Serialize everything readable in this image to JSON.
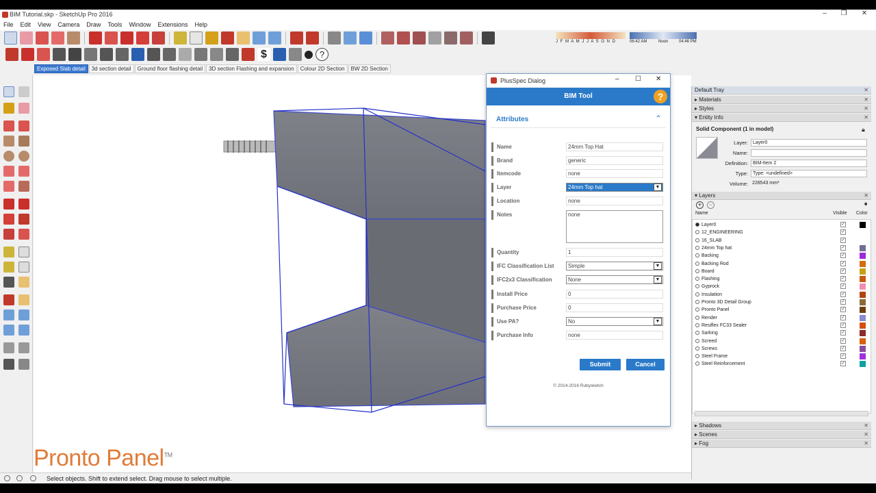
{
  "window": {
    "title": "BIM Tutorial.skp - SketchUp Pro 2016"
  },
  "menu": [
    "File",
    "Edit",
    "View",
    "Camera",
    "Draw",
    "Tools",
    "Window",
    "Extensions",
    "Help"
  ],
  "toolbar_shadow": {
    "months": "J F M A M J J A S O N D",
    "time_start": "06:42 AM",
    "noon": "Noon",
    "time_end": "04:46 PM"
  },
  "scene_tabs": [
    "Exposed Slab detail",
    "3d section detail",
    "Ground floor flashing detail",
    "3D section Flashing and expansion",
    "Colour 2D Section",
    "BW 2D Section"
  ],
  "brand": {
    "name": "Pronto Panel",
    "tm": "TM"
  },
  "status": {
    "message": "Select objects. Shift to extend select. Drag mouse to select multiple."
  },
  "dialog": {
    "title": "PlusSpec Dialog",
    "header": "BIM Tool",
    "help": "?",
    "section": "Attributes",
    "fields": [
      {
        "label": "Name",
        "value": "24mm Top Hat",
        "kind": "text"
      },
      {
        "label": "Brand",
        "value": "generic",
        "kind": "text"
      },
      {
        "label": "Itemcode",
        "value": "none",
        "kind": "text"
      },
      {
        "label": "Layer",
        "value": "24mm Top hat",
        "kind": "select-hl"
      },
      {
        "label": "Location",
        "value": "none",
        "kind": "text"
      },
      {
        "label": "Notes",
        "value": "none",
        "kind": "textarea"
      },
      {
        "label": "Quantity",
        "value": "1",
        "kind": "text"
      },
      {
        "label": "IFC Classification List",
        "value": "Simple",
        "kind": "select"
      },
      {
        "label": "IFC2x3 Classification",
        "value": "None",
        "kind": "select"
      },
      {
        "label": "Install Price",
        "value": "0",
        "kind": "text"
      },
      {
        "label": "Purchase Price",
        "value": "0",
        "kind": "text"
      },
      {
        "label": "Use PA?",
        "value": "No",
        "kind": "select"
      },
      {
        "label": "Purchase Info",
        "value": "none",
        "kind": "text"
      }
    ],
    "submit": "Submit",
    "cancel": "Cancel",
    "copyright": "© 2014-2016 Rubysketch"
  },
  "tray": {
    "title": "Default Tray",
    "sections": {
      "materials": "Materials",
      "styles": "Styles",
      "entity_info": "Entity Info",
      "layers": "Layers",
      "shadows": "Shadows",
      "scenes": "Scenes",
      "fog": "Fog"
    },
    "entity": {
      "heading": "Solid Component (1 in model)",
      "layer_label": "Layer:",
      "layer": "Layer0",
      "name_label": "Name:",
      "name": "",
      "definition_label": "Definition:",
      "definition": "BIM-Item 2",
      "type_label": "Type:",
      "type": "Type: <undefined>",
      "volume_label": "Volume:",
      "volume": "228543 mm³"
    },
    "layers_cols": {
      "name": "Name",
      "visible": "Visible",
      "color": "Color"
    },
    "layers": [
      {
        "name": "Layer0",
        "active": true,
        "color": "#000000"
      },
      {
        "name": "12_ENGINEERING",
        "active": false,
        "color": ""
      },
      {
        "name": "16_SLAB",
        "active": false,
        "color": ""
      },
      {
        "name": "24mm Top hat",
        "active": false,
        "color": "#6f6f90"
      },
      {
        "name": "Backing",
        "active": false,
        "color": "#9b2bd9"
      },
      {
        "name": "Backing Rod",
        "active": false,
        "color": "#d46a12"
      },
      {
        "name": "Board",
        "active": false,
        "color": "#c4a212"
      },
      {
        "name": "Flashing",
        "active": false,
        "color": "#c45a10"
      },
      {
        "name": "Gyprock",
        "active": false,
        "color": "#f08fb0"
      },
      {
        "name": "Insulation",
        "active": false,
        "color": "#b04410"
      },
      {
        "name": "Pronto 3D Detail Group",
        "active": false,
        "color": "#8a6a3a"
      },
      {
        "name": "Pronto Panel",
        "active": false,
        "color": "#6b3f10"
      },
      {
        "name": "Render",
        "active": false,
        "color": "#8a8ad0"
      },
      {
        "name": "Resiflex FC33 Sealer",
        "active": false,
        "color": "#d45010"
      },
      {
        "name": "Sarking",
        "active": false,
        "color": "#8a2a2a"
      },
      {
        "name": "Screed",
        "active": false,
        "color": "#d86010"
      },
      {
        "name": "Screws",
        "active": false,
        "color": "#8a4aa0"
      },
      {
        "name": "Steel Frame",
        "active": false,
        "color": "#a030e0"
      },
      {
        "name": "Steel Reinforcement",
        "active": false,
        "color": "#10a0a0"
      }
    ]
  }
}
